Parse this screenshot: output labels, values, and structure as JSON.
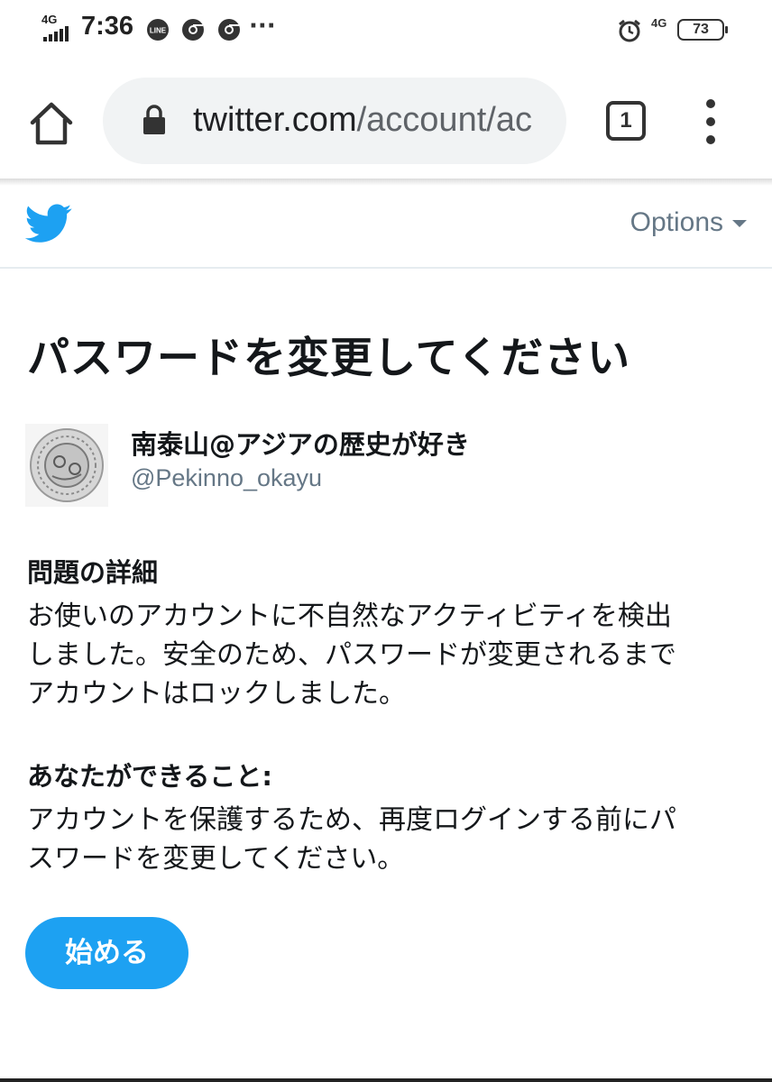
{
  "status_bar": {
    "network_left": "4G",
    "time": "7:36",
    "notification_icons": [
      "line-icon",
      "chrome-icon",
      "chrome-icon"
    ],
    "more": "···",
    "network_right": "4G",
    "battery": "73"
  },
  "browser": {
    "url_host": "twitter.com",
    "url_path": "/account/ac",
    "tab_count": "1"
  },
  "twitter_header": {
    "options_label": "Options"
  },
  "page": {
    "title": "パスワードを変更してください",
    "account": {
      "display_name": "南泰山@アジアの歴史が好き",
      "handle": "@Pekinno_okayu"
    },
    "problem_heading": "問題の詳細",
    "problem_lines": [
      "お使いのアカウントに不自然なアクティビティを検出",
      "しました。安全のため、パスワードが変更されるまで",
      "アカウントはロックしました。"
    ],
    "todo_heading": "あなたができること:",
    "todo_lines": [
      "アカウントを保護するため、再度ログインする前にパ",
      "スワードを変更してください。"
    ],
    "start_button": "始める"
  },
  "colors": {
    "twitter_blue": "#1da1f2",
    "text_primary": "#14171a",
    "text_secondary": "#657786",
    "urlbar_bg": "#f1f3f4"
  }
}
